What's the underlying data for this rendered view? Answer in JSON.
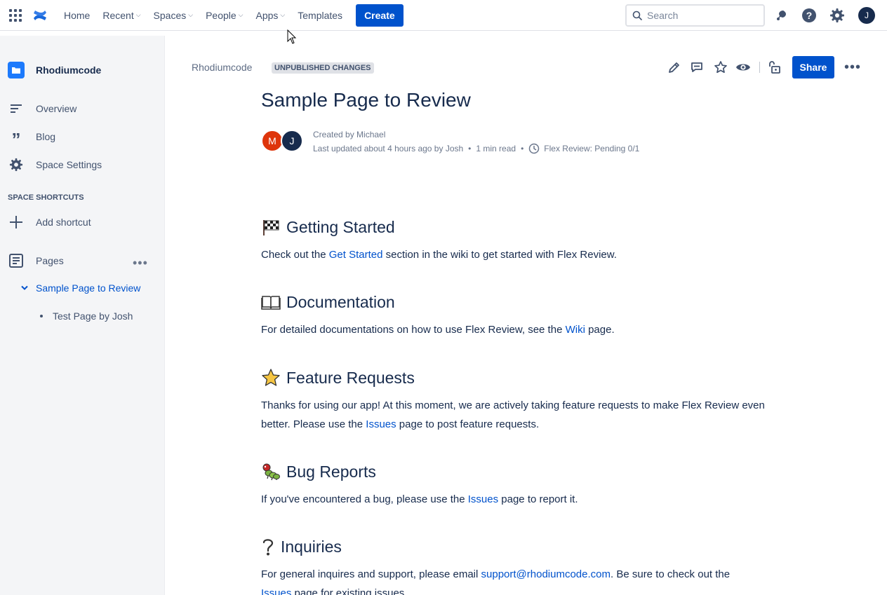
{
  "nav": {
    "items": [
      {
        "label": "Home",
        "dropdown": false
      },
      {
        "label": "Recent",
        "dropdown": true
      },
      {
        "label": "Spaces",
        "dropdown": true
      },
      {
        "label": "People",
        "dropdown": true
      },
      {
        "label": "Apps",
        "dropdown": true
      },
      {
        "label": "Templates",
        "dropdown": false
      }
    ],
    "create_label": "Create",
    "search_placeholder": "Search",
    "avatar_initial": "J"
  },
  "sidebar": {
    "space_name": "Rhodiumcode",
    "items": [
      {
        "label": "Overview",
        "icon": "overview-icon"
      },
      {
        "label": "Blog",
        "icon": "quote-icon"
      },
      {
        "label": "Space Settings",
        "icon": "gear-icon"
      }
    ],
    "shortcuts_heading": "SPACE SHORTCUTS",
    "add_shortcut_label": "Add shortcut",
    "pages_label": "Pages",
    "tree": [
      {
        "label": "Sample Page to Review",
        "active": true
      },
      {
        "label": "Test Page by Josh",
        "active": false
      }
    ]
  },
  "page": {
    "breadcrumb": "Rhodiumcode",
    "status_lozenge": "UNPUBLISHED CHANGES",
    "share_label": "Share",
    "title": "Sample Page to Review",
    "avatars": [
      {
        "initial": "M",
        "color": "#de350b"
      },
      {
        "initial": "J",
        "color": "#172b4d"
      }
    ],
    "created_by": "Created by Michael",
    "last_updated": "Last updated about 4 hours ago by Josh",
    "read_time": "1 min read",
    "flex_review": "Flex Review: Pending 0/1",
    "sections": [
      {
        "heading": "Getting Started",
        "emoji": "checkered-flag-icon",
        "text_before": "Check out the ",
        "link": "Get Started",
        "text_after": " section in the wiki to get started with Flex Review."
      },
      {
        "heading": "Documentation",
        "emoji": "open-book-icon",
        "text_before": "For detailed documentations on how to use Flex Review, see the ",
        "link": "Wiki",
        "text_after": " page."
      },
      {
        "heading": "Feature Requests",
        "emoji": "star-icon",
        "text_before": "Thanks for using our app! At this moment, we are actively taking feature requests to make Flex Review even better. Please use the ",
        "link": "Issues",
        "text_after": " page to post feature requests."
      },
      {
        "heading": "Bug Reports",
        "emoji": "bug-icon",
        "text_before": "If you've encountered a bug, please use the ",
        "link": "Issues",
        "text_after": " page to report it."
      },
      {
        "heading": "Inquiries",
        "emoji": "question-mark-icon",
        "text_before": "For general inquires and support, please email ",
        "link": "support@rhodiumcode.com",
        "text_middle": ". Be sure to check out the ",
        "link2": "Issues",
        "text_after": " page for existing issues."
      }
    ]
  },
  "colors": {
    "brand_blue": "#0052cc",
    "text_primary": "#172b4d",
    "sidebar_bg": "#f4f5f7"
  }
}
